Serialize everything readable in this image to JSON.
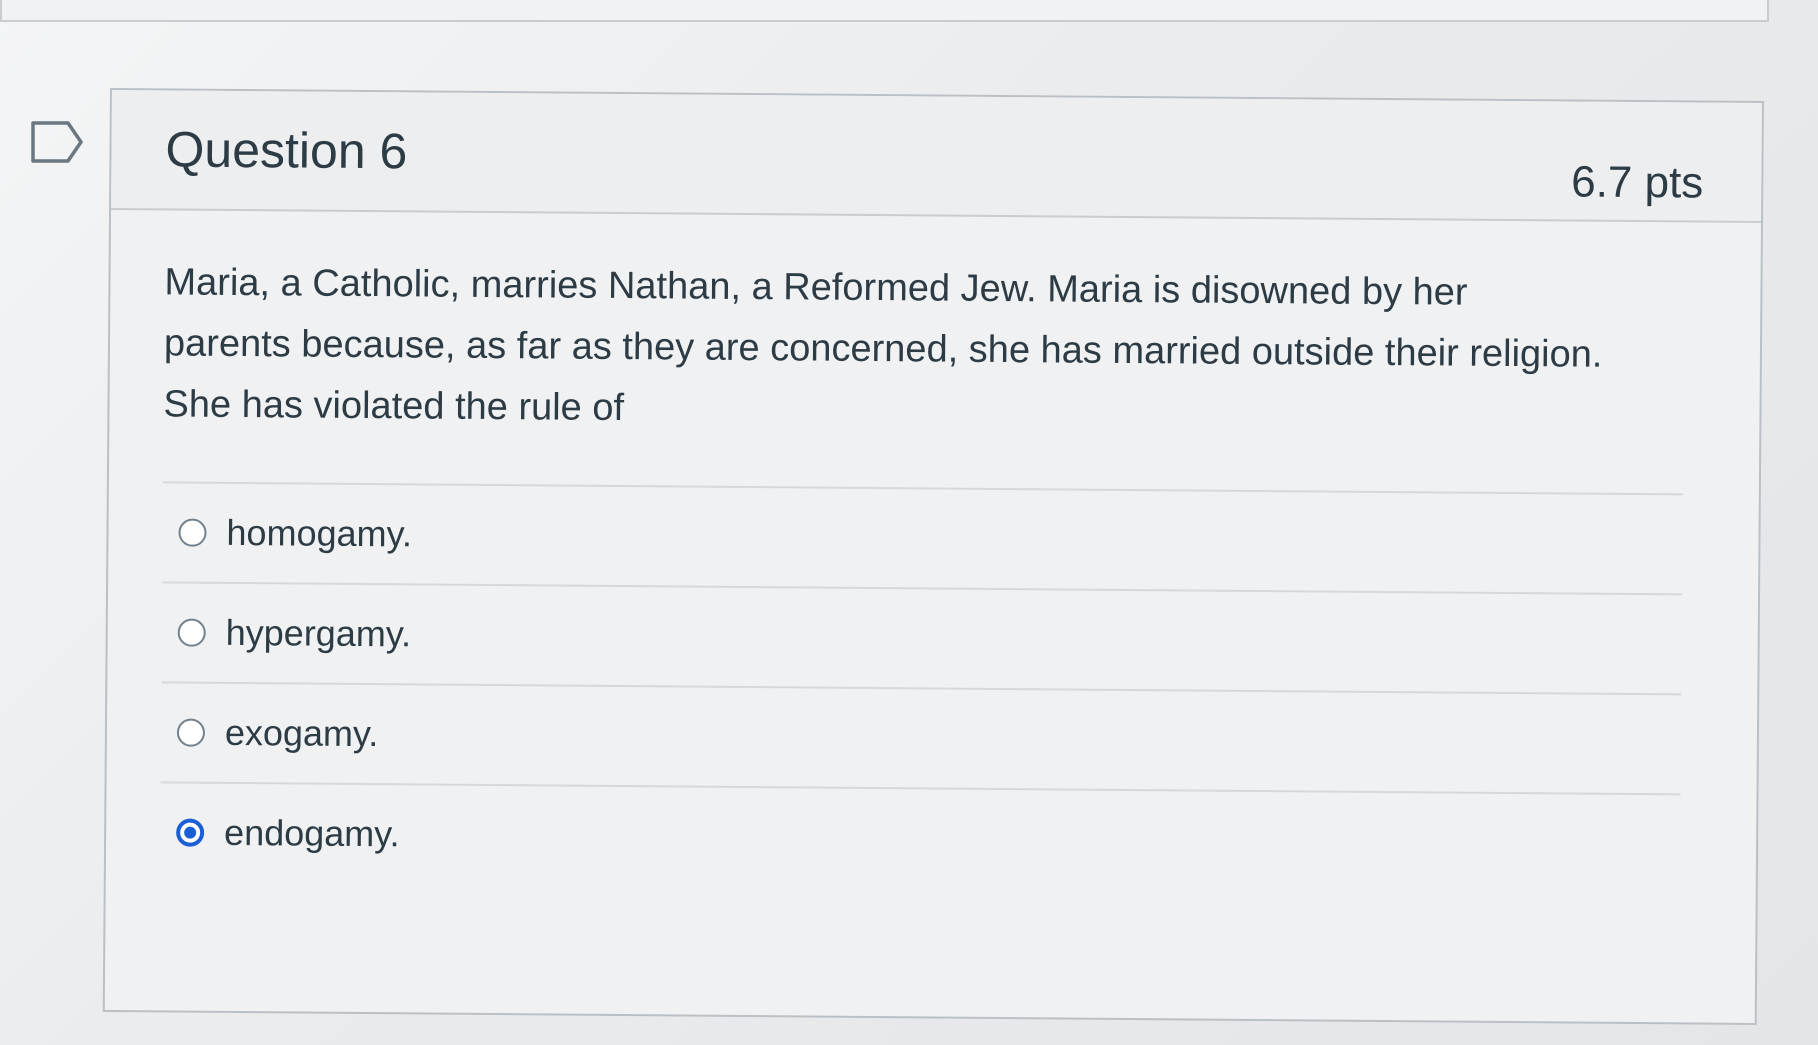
{
  "question": {
    "title": "Question 6",
    "points": "6.7 pts",
    "text": "Maria, a Catholic, marries Nathan, a Reformed Jew. Maria is disowned by her parents because, as far as they are concerned, she has married outside their religion. She has violated the rule of",
    "answers": [
      {
        "label": "homogamy.",
        "selected": false
      },
      {
        "label": "hypergamy.",
        "selected": false
      },
      {
        "label": "exogamy.",
        "selected": false
      },
      {
        "label": "endogamy.",
        "selected": true
      }
    ]
  },
  "colors": {
    "text": "#2d3b45",
    "selected_radio": "#1a5fd6",
    "border": "#c7cdd1"
  },
  "icons": {
    "flag": "bookmark-flag-icon"
  }
}
